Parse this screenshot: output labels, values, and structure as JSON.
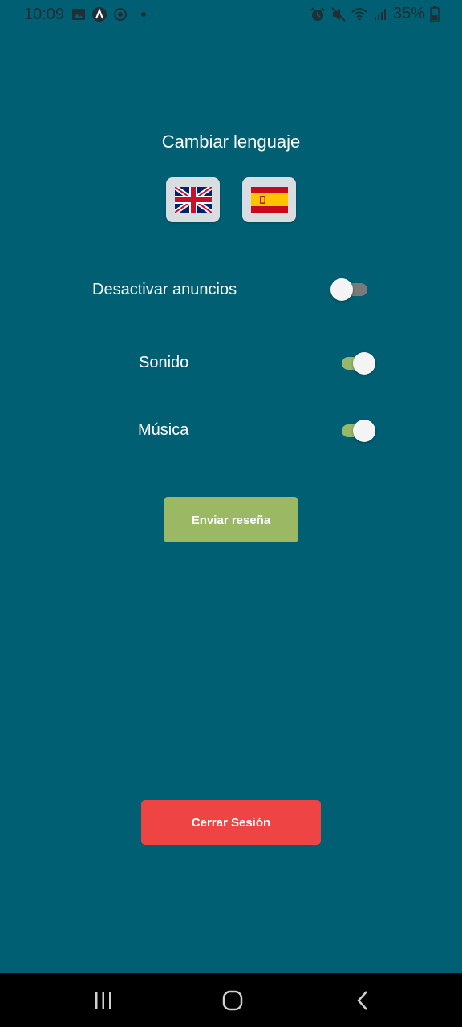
{
  "status_bar": {
    "time": "10:09",
    "battery": "35%",
    "left_icons": [
      "image-icon",
      "app-a-icon",
      "sync-icon",
      "notification-dot"
    ],
    "right_icons": [
      "alarm-icon",
      "mute-icon",
      "wifi-icon",
      "signal-icon",
      "battery-icon"
    ]
  },
  "language": {
    "title": "Cambiar lenguaje",
    "options": [
      {
        "icon": "uk-flag-icon"
      },
      {
        "icon": "spain-flag-icon"
      }
    ]
  },
  "settings": [
    {
      "label": "Desactivar anuncios",
      "enabled": false
    },
    {
      "label": "Sonido",
      "enabled": true
    },
    {
      "label": "Música",
      "enabled": true
    }
  ],
  "buttons": {
    "review": "Enviar reseña",
    "logout": "Cerrar Sesión"
  },
  "colors": {
    "background": "#005f73",
    "review_button": "#9bb865",
    "logout_button": "#ef4444",
    "toggle_on": "#97b86a",
    "toggle_off": "#7a7a7a"
  },
  "nav_bar": {
    "icons": [
      "recent-apps-icon",
      "home-icon",
      "back-icon"
    ]
  }
}
